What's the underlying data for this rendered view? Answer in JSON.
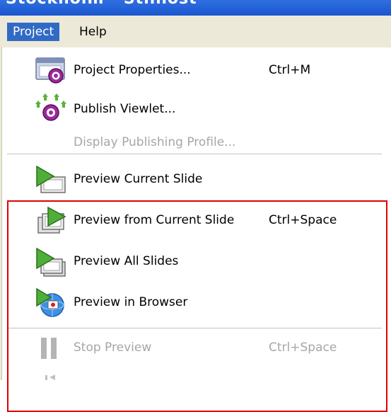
{
  "window": {
    "title_fragment": "Stockholm - Stilnost"
  },
  "menubar": {
    "items": [
      {
        "label": "Project",
        "active": true
      },
      {
        "label": "Help",
        "active": false
      }
    ]
  },
  "menu": {
    "items": [
      {
        "label": "Project Properties...",
        "shortcut": "Ctrl+M",
        "icon": "project-properties-icon",
        "enabled": true
      },
      {
        "label": "Publish Viewlet...",
        "shortcut": "",
        "icon": "publish-icon",
        "enabled": true
      },
      {
        "label": "Display Publishing Profile...",
        "shortcut": "",
        "icon": "",
        "enabled": false
      },
      {
        "label": "Preview Current Slide",
        "shortcut": "",
        "icon": "preview-slide-icon",
        "enabled": true
      },
      {
        "label": "Preview from Current Slide",
        "shortcut": "Ctrl+Space",
        "icon": "preview-from-slide-icon",
        "enabled": true
      },
      {
        "label": "Preview All Slides",
        "shortcut": "",
        "icon": "preview-all-icon",
        "enabled": true
      },
      {
        "label": "Preview in Browser",
        "shortcut": "",
        "icon": "preview-browser-icon",
        "enabled": true
      },
      {
        "label": "Stop Preview",
        "shortcut": "Ctrl+Space",
        "icon": "pause-icon",
        "enabled": false
      }
    ]
  },
  "colors": {
    "highlight": "#e00000",
    "menu_selected": "#316ac5",
    "titlebar": "#1a56cf",
    "disabled_text": "#a6a6a6"
  }
}
